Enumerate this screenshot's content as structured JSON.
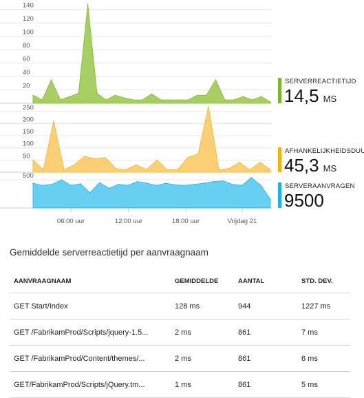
{
  "metrics": {
    "reactietijd": {
      "label": "SERVERREACTIETIJD",
      "value": "14,5",
      "unit": "MS",
      "color": "#7ab829"
    },
    "afhankelijkheid": {
      "label": "AFHANKELIJKHEIDSDUUR",
      "value": "45,3",
      "unit": "MS",
      "color": "#f7b500"
    },
    "aanvragen": {
      "label": "SERVERAANVRAGEN",
      "value": "9500",
      "color": "#1ab3e6"
    }
  },
  "chart_data": [
    {
      "type": "area",
      "series": [
        {
          "name": "SERVERREACTIETIJD",
          "values": [
            12,
            5,
            35,
            5,
            10,
            15,
            148,
            15,
            5,
            12,
            8,
            5,
            5,
            14,
            5,
            5,
            5,
            5,
            12,
            12,
            35,
            5,
            5,
            10,
            5,
            10,
            2
          ]
        }
      ],
      "y_ticks": [
        "20",
        "40",
        "60",
        "80",
        "100",
        "120",
        "140"
      ],
      "ylim": [
        0,
        150
      ],
      "grid": true
    },
    {
      "type": "area",
      "series": [
        {
          "name": "AFHANKELIJKHEIDSDUUR",
          "values": [
            50,
            10,
            210,
            10,
            30,
            65,
            55,
            60,
            15,
            10,
            30,
            10,
            50,
            10,
            10,
            60,
            75,
            270,
            10,
            15,
            40,
            10,
            40,
            10
          ]
        }
      ],
      "y_ticks": [
        "50",
        "100",
        "150",
        "200",
        "250"
      ],
      "ylim": [
        0,
        275
      ],
      "grid": true
    },
    {
      "type": "area",
      "series": [
        {
          "name": "SERVERAANVRAGEN",
          "values": [
            440,
            400,
            420,
            500,
            400,
            430,
            270,
            450,
            350,
            420,
            400,
            470,
            440,
            400,
            440,
            410,
            400,
            420,
            440,
            470,
            480,
            420,
            400,
            540,
            400,
            150
          ]
        }
      ],
      "y_ticks": [
        "500"
      ],
      "ylim": [
        0,
        600
      ],
      "grid": true
    }
  ],
  "x_ticks": [
    "06:00 uur",
    "12:00 uur",
    "18:00 uur",
    "Vrijdag 21"
  ],
  "section_title": "Gemiddelde serverreactietijd per aanvraagnaam",
  "table": {
    "headers": [
      "AANVRAAGNAAM",
      "GEMIDDELDE",
      "AANTAL",
      "STD. DEV."
    ],
    "rows": [
      [
        "GET Start/Index",
        "128 ms",
        "944",
        "1227 ms"
      ],
      [
        "GET /FabrikamProd/Scripts/jquery-1.5...",
        "2 ms",
        "861",
        "7 ms"
      ],
      [
        "GET /FabrikamProd/Content/themes/...",
        "2 ms",
        "861",
        "6 ms"
      ],
      [
        "GET/FabrikamProd/Scripts/jQuery.tm...",
        "1 ms",
        "861",
        "5 ms"
      ]
    ]
  }
}
